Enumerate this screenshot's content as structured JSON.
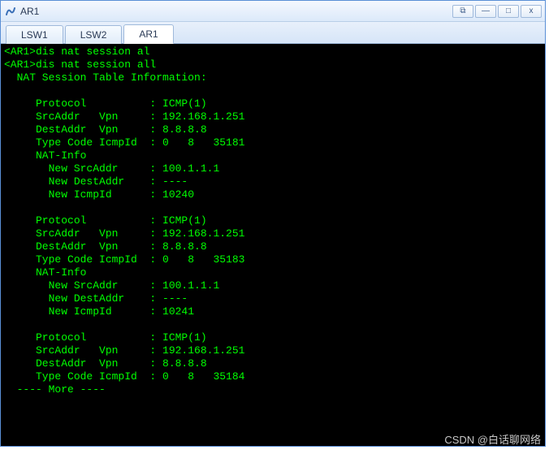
{
  "window": {
    "title": "AR1"
  },
  "tabs": [
    {
      "label": "LSW1",
      "active": false
    },
    {
      "label": "LSW2",
      "active": false
    },
    {
      "label": "AR1",
      "active": true
    }
  ],
  "terminal": {
    "prompt_device": "AR1",
    "lines": [
      "<AR1>dis nat session al",
      "<AR1>dis nat session all",
      "  NAT Session Table Information:",
      "",
      "     Protocol          : ICMP(1)",
      "     SrcAddr   Vpn     : 192.168.1.251",
      "     DestAddr  Vpn     : 8.8.8.8",
      "     Type Code IcmpId  : 0   8   35181",
      "     NAT-Info",
      "       New SrcAddr     : 100.1.1.1",
      "       New DestAddr    : ----",
      "       New IcmpId      : 10240",
      "",
      "     Protocol          : ICMP(1)",
      "     SrcAddr   Vpn     : 192.168.1.251",
      "     DestAddr  Vpn     : 8.8.8.8",
      "     Type Code IcmpId  : 0   8   35183",
      "     NAT-Info",
      "       New SrcAddr     : 100.1.1.1",
      "       New DestAddr    : ----",
      "       New IcmpId      : 10241",
      "",
      "     Protocol          : ICMP(1)",
      "     SrcAddr   Vpn     : 192.168.1.251",
      "     DestAddr  Vpn     : 8.8.8.8",
      "     Type Code IcmpId  : 0   8   35184",
      "  ---- More ----"
    ],
    "sessions": [
      {
        "protocol": "ICMP(1)",
        "src_addr_vpn": "192.168.1.251",
        "dest_addr_vpn": "8.8.8.8",
        "type": 0,
        "code": 8,
        "icmp_id": 35181,
        "nat_info": {
          "new_src_addr": "100.1.1.1",
          "new_dest_addr": "----",
          "new_icmp_id": 10240
        }
      },
      {
        "protocol": "ICMP(1)",
        "src_addr_vpn": "192.168.1.251",
        "dest_addr_vpn": "8.8.8.8",
        "type": 0,
        "code": 8,
        "icmp_id": 35183,
        "nat_info": {
          "new_src_addr": "100.1.1.1",
          "new_dest_addr": "----",
          "new_icmp_id": 10241
        }
      },
      {
        "protocol": "ICMP(1)",
        "src_addr_vpn": "192.168.1.251",
        "dest_addr_vpn": "8.8.8.8",
        "type": 0,
        "code": 8,
        "icmp_id": 35184
      }
    ],
    "more_prompt": "---- More ----"
  },
  "watermark": "CSDN @白话聊网络",
  "winbuttons": {
    "undock": "⧉",
    "minimize": "—",
    "maximize": "□",
    "close": "x"
  }
}
